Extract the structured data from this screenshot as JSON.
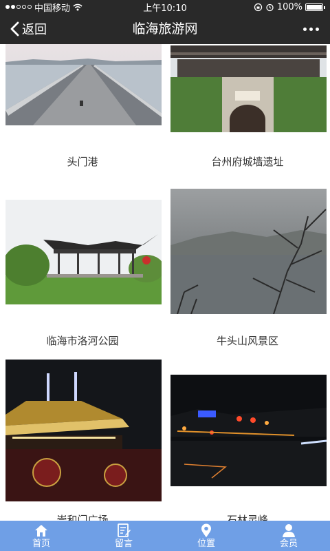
{
  "status_bar": {
    "carrier": "中国移动",
    "time": "上午10:10",
    "battery": "100%",
    "icons": [
      "signal-dots",
      "wifi-icon",
      "lock-rotation-icon",
      "alarm-icon",
      "battery-icon"
    ]
  },
  "header": {
    "back_label": "返回",
    "title": "临海旅游网",
    "back_icon": "chevron-left-icon",
    "more_icon": "more-dots-icon"
  },
  "attractions": [
    {
      "name": "头门港",
      "scene": "bridge-sea"
    },
    {
      "name": "台州府城墙遗址",
      "scene": "city-gate"
    },
    {
      "name": "临海市洛河公园",
      "scene": "pavilion-park"
    },
    {
      "name": "牛头山风景区",
      "scene": "misty-lake"
    },
    {
      "name": "崇和门广场",
      "scene": "night-tower"
    },
    {
      "name": "石林灵峰",
      "scene": "night-street"
    }
  ],
  "tabs": [
    {
      "label": "首页",
      "icon": "home-icon"
    },
    {
      "label": "留言",
      "icon": "message-edit-icon"
    },
    {
      "label": "位置",
      "icon": "location-pin-icon"
    },
    {
      "label": "会员",
      "icon": "user-icon"
    }
  ],
  "colors": {
    "nav_background": "#292929",
    "tab_bar_background": "#6f9fe6",
    "caption_text": "#333333"
  }
}
